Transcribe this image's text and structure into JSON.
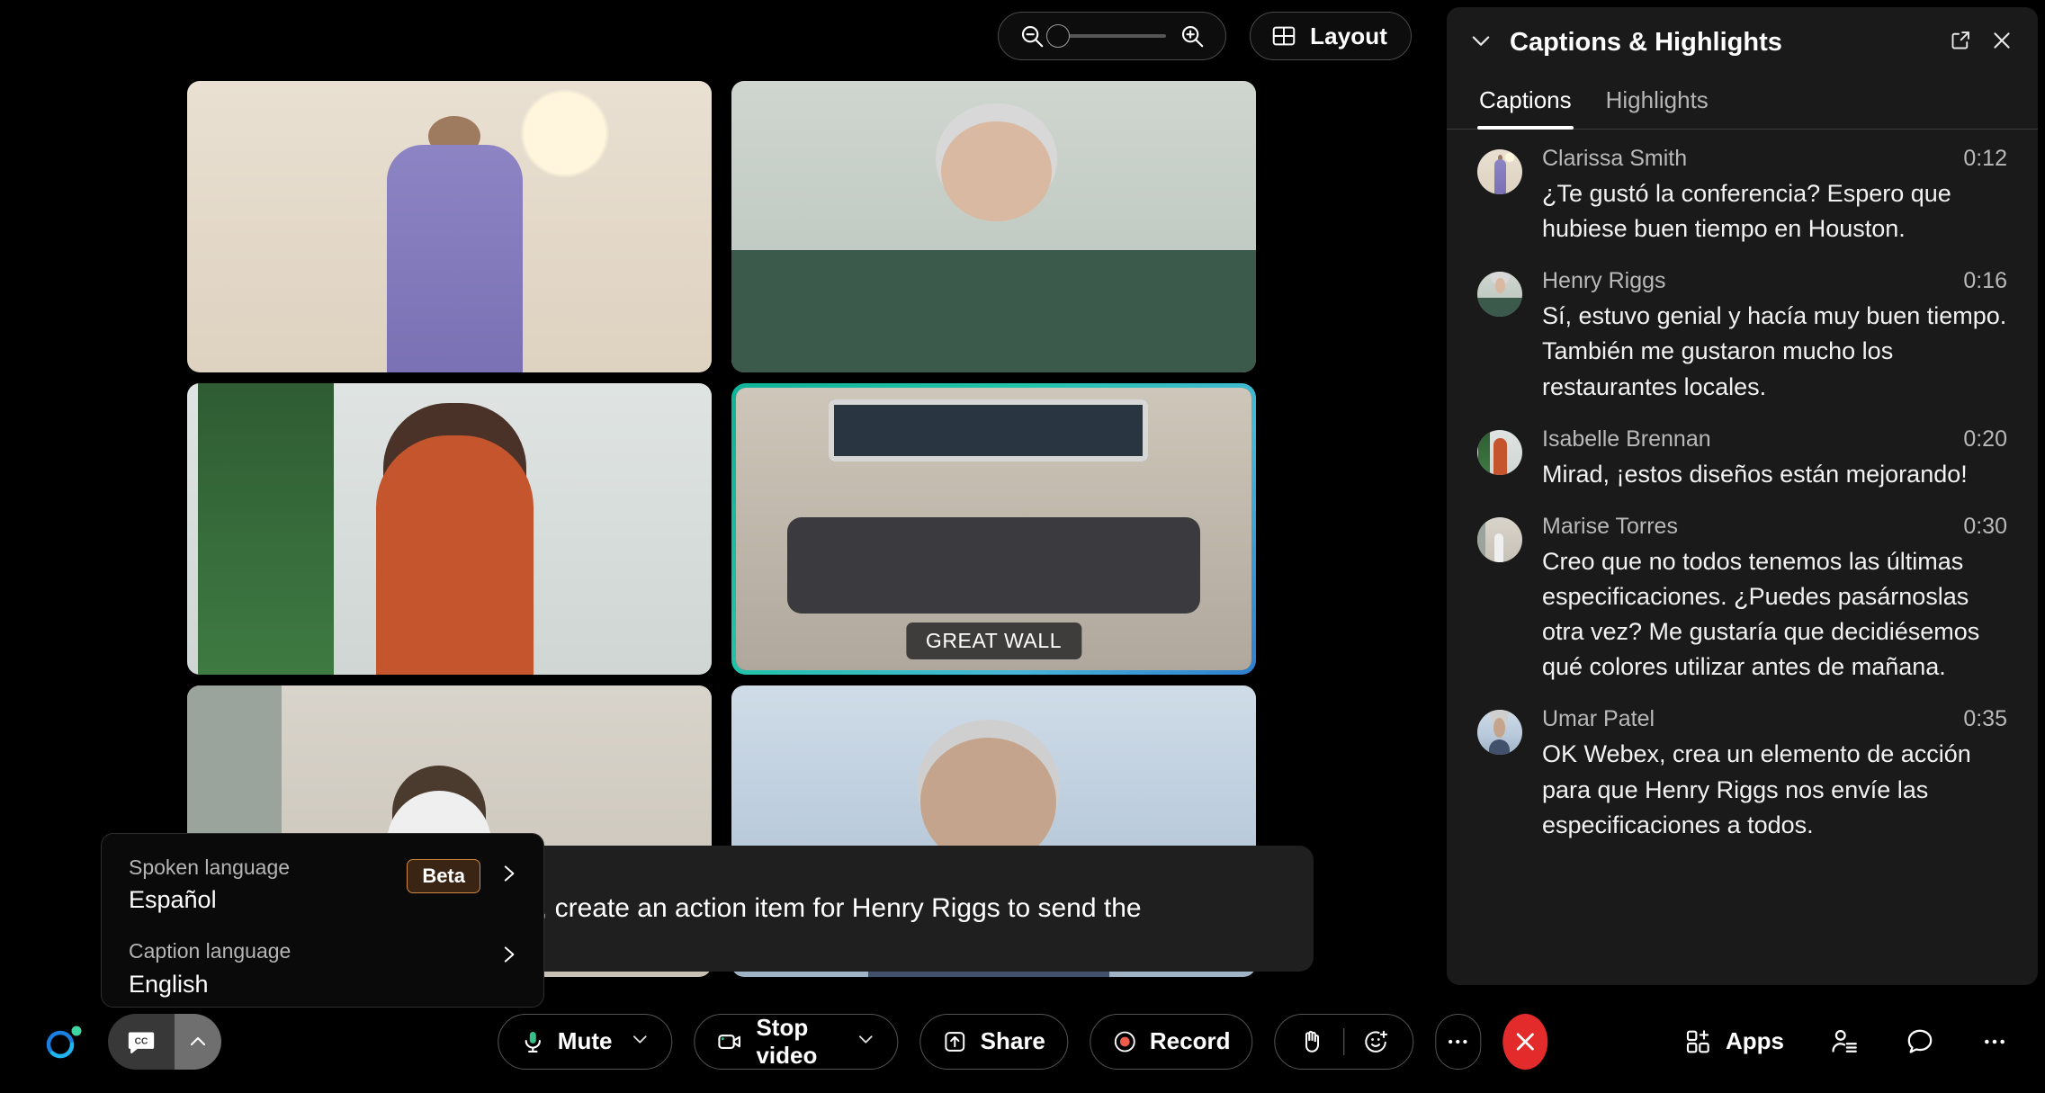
{
  "topbar": {
    "zoom_out_icon": "zoom-out-icon",
    "zoom_in_icon": "zoom-in-icon",
    "zoom_level": 0,
    "layout_label": "Layout"
  },
  "grid": {
    "tiles": [
      {
        "id": "clarissa",
        "name": "",
        "active": false,
        "scene": "s-clarissa"
      },
      {
        "id": "henry",
        "name": "",
        "active": false,
        "scene": "s-henry"
      },
      {
        "id": "isabelle",
        "name": "",
        "active": false,
        "scene": "s-isabelle"
      },
      {
        "id": "great-wall",
        "name": "GREAT WALL",
        "active": true,
        "scene": "s-room"
      },
      {
        "id": "marise",
        "name": "",
        "active": false,
        "scene": "s-marise"
      },
      {
        "id": "umar",
        "name": "",
        "active": false,
        "scene": "s-umar"
      }
    ]
  },
  "caption_overlay": {
    "text": "OK Webex, create an action item for Henry Riggs to send the"
  },
  "language_popup": {
    "spoken": {
      "label": "Spoken language",
      "value": "Español",
      "badge": "Beta"
    },
    "caption": {
      "label": "Caption language",
      "value": "English"
    }
  },
  "toolbar": {
    "cc_label": "cc",
    "mute_label": "Mute",
    "stop_video_label": "Stop video",
    "share_label": "Share",
    "record_label": "Record",
    "more_label": "…",
    "apps_label": "Apps"
  },
  "panel": {
    "title": "Captions & Highlights",
    "tabs": [
      {
        "label": "Captions",
        "active": true
      },
      {
        "label": "Highlights",
        "active": false
      }
    ],
    "captions": [
      {
        "name": "Clarissa Smith",
        "time": "0:12",
        "text": "¿Te gustó la conferencia? Espero que hubiese buen tiempo en Houston.",
        "avatar": "s-clarissa"
      },
      {
        "name": "Henry Riggs",
        "time": "0:16",
        "text": "Sí, estuvo genial y hacía muy buen tiempo. También me gustaron mucho los restaurantes locales.",
        "avatar": "s-henry"
      },
      {
        "name": "Isabelle Brennan",
        "time": "0:20",
        "text": "Mirad, ¡estos diseños están mejorando!",
        "avatar": "s-isabelle"
      },
      {
        "name": "Marise Torres",
        "time": "0:30",
        "text": "Creo que no todos tenemos las últimas especificaciones. ¿Puedes pasárnoslas otra vez? Me gustaría que decidiésemos qué colores utilizar antes de mañana.",
        "avatar": "s-marise"
      },
      {
        "name": "Umar Patel",
        "time": "0:35",
        "text": "OK Webex, crea un elemento de acción para que Henry Riggs nos envíe las especificaciones a todos.",
        "avatar": "s-umar"
      }
    ]
  },
  "colors": {
    "accent_teal": "#0fb39a",
    "end_red": "#e32b2b",
    "record_red": "#ef5b4c",
    "mic_green": "#35c08a",
    "beta_border": "#d2873f",
    "panel_bg": "#1a1a1a"
  }
}
